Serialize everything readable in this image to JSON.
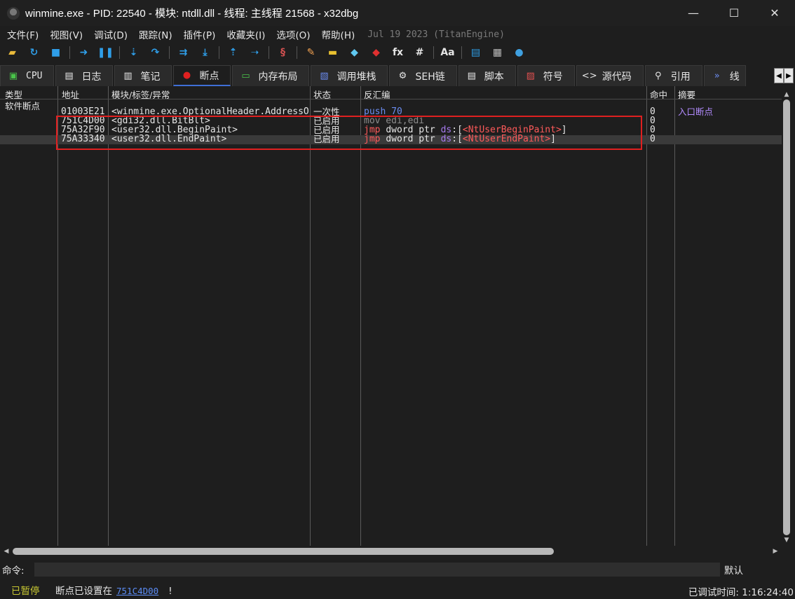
{
  "window": {
    "title": "winmine.exe - PID: 22540 - 模块: ntdll.dll - 线程: 主线程 21568 - x32dbg",
    "controls": {
      "minimize": "—",
      "maximize": "☐",
      "close": "✕"
    }
  },
  "menu": {
    "items": [
      "文件(F)",
      "视图(V)",
      "调试(D)",
      "跟踪(N)",
      "插件(P)",
      "收藏夹(I)",
      "选项(O)",
      "帮助(H)"
    ],
    "build_date": "Jul 19 2023 (TitanEngine)"
  },
  "toolbar": {
    "buttons": [
      {
        "icon": "open-folder-icon",
        "glyph": "▰",
        "color": "#e8b93a"
      },
      {
        "icon": "restart-icon",
        "glyph": "↻",
        "color": "#2f9ee8"
      },
      {
        "icon": "stop-icon",
        "glyph": "■",
        "color": "#2f9ee8"
      },
      {
        "icon": "run-icon",
        "glyph": "➜",
        "color": "#2f9ee8"
      },
      {
        "icon": "pause-icon",
        "glyph": "❚❚",
        "color": "#2f9ee8"
      },
      {
        "icon": "step-into-icon",
        "glyph": "⇣",
        "color": "#2f9ee8"
      },
      {
        "icon": "step-over-icon",
        "glyph": "↷",
        "color": "#2f9ee8"
      },
      {
        "icon": "trace-into-icon",
        "glyph": "⇉",
        "color": "#2f9ee8"
      },
      {
        "icon": "trace-over-icon",
        "glyph": "⤓",
        "color": "#2f9ee8"
      },
      {
        "icon": "execute-till-return-icon",
        "glyph": "⇡",
        "color": "#2f9ee8"
      },
      {
        "icon": "run-to-user-code-icon",
        "glyph": "➝",
        "color": "#2f9ee8"
      },
      {
        "icon": "scylla-icon",
        "glyph": "§",
        "color": "#d05050"
      },
      {
        "icon": "patch-icon",
        "glyph": "✎",
        "color": "#f0a050"
      },
      {
        "icon": "comments-icon",
        "glyph": "▬",
        "color": "#e8c030"
      },
      {
        "icon": "labels-icon",
        "glyph": "◆",
        "color": "#60c8f0"
      },
      {
        "icon": "bookmarks-icon",
        "glyph": "◆",
        "color": "#e03030"
      },
      {
        "icon": "functions-icon",
        "glyph": "fx",
        "color": "#e6e6e6"
      },
      {
        "icon": "hash-icon",
        "glyph": "#",
        "color": "#e6e6e6"
      },
      {
        "icon": "font-icon",
        "glyph": "Aa",
        "color": "#e6e6e6"
      },
      {
        "icon": "calculator-script-icon",
        "glyph": "▤",
        "color": "#2f9ee8"
      },
      {
        "icon": "calculator-icon",
        "glyph": "▦",
        "color": "#bdbdbd"
      },
      {
        "icon": "globe-icon",
        "glyph": "●",
        "color": "#3fa0e0"
      }
    ]
  },
  "tabs": [
    {
      "icon": "cpu-icon",
      "glyph": "▣",
      "color": "#49c449",
      "label": "CPU"
    },
    {
      "icon": "log-icon",
      "glyph": "▤",
      "color": "#e6e6e6",
      "label": "日志"
    },
    {
      "icon": "notes-icon",
      "glyph": "▥",
      "color": "#e6e6e6",
      "label": "笔记"
    },
    {
      "icon": "breakpoint-dot-icon",
      "glyph": "●",
      "color": "#e02020",
      "label": "断点",
      "active": true
    },
    {
      "icon": "memory-map-icon",
      "glyph": "▭",
      "color": "#49c449",
      "label": "内存布局"
    },
    {
      "icon": "call-stack-icon",
      "glyph": "▧",
      "color": "#6b8cf0",
      "label": "调用堆栈"
    },
    {
      "icon": "seh-chain-icon",
      "glyph": "⚙",
      "color": "#e6e6e6",
      "label": "SEH链"
    },
    {
      "icon": "script-icon",
      "glyph": "▤",
      "color": "#e6e6e6",
      "label": "脚本"
    },
    {
      "icon": "symbols-icon",
      "glyph": "▨",
      "color": "#e05050",
      "label": "符号"
    },
    {
      "icon": "source-icon",
      "glyph": "<>",
      "color": "#e6e6e6",
      "label": "源代码"
    },
    {
      "icon": "references-icon",
      "glyph": "⚲",
      "color": "#e6e6e6",
      "label": "引用"
    },
    {
      "icon": "threads-icon",
      "glyph": "»",
      "color": "#6b8cf0",
      "label": "线"
    }
  ],
  "breakpoints": {
    "headers": {
      "type": "类型",
      "address": "地址",
      "module": "模块/标签/异常",
      "state": "状态",
      "disassembly": "反汇编",
      "hits": "命中",
      "summary": "摘要"
    },
    "group_label": "软件断点",
    "rows": [
      {
        "address": "01003E21",
        "module": "<winmine.exe.OptionalHeader.AddressOfEntryPoint>",
        "state": "一次性",
        "dis": [
          {
            "t": "push ",
            "c": "c-blue"
          },
          {
            "t": "70",
            "c": "c-blue"
          }
        ],
        "hits": "0",
        "summary": "入口断点"
      },
      {
        "address": "751C4D00",
        "module": "<gdi32.dll.BitBlt>",
        "state": "已启用",
        "dis": [
          {
            "t": "mov edi,edi",
            "c": "c-gray"
          }
        ],
        "hits": "0",
        "summary": ""
      },
      {
        "address": "75A32F90",
        "module": "<user32.dll.BeginPaint>",
        "state": "已启用",
        "dis": [
          {
            "t": "jmp ",
            "c": "c-red"
          },
          {
            "t": "dword ptr ",
            "c": "c-white"
          },
          {
            "t": "ds",
            "c": "c-purple"
          },
          {
            "t": ":[",
            "c": "c-white"
          },
          {
            "t": "<NtUserBeginPaint>",
            "c": "c-red"
          },
          {
            "t": "]",
            "c": "c-white"
          }
        ],
        "hits": "0",
        "summary": ""
      },
      {
        "address": "75A33340",
        "module": "<user32.dll.EndPaint>",
        "state": "已启用",
        "dis": [
          {
            "t": "jmp ",
            "c": "c-red"
          },
          {
            "t": "dword ptr ",
            "c": "c-white"
          },
          {
            "t": "ds",
            "c": "c-purple"
          },
          {
            "t": ":[",
            "c": "c-white"
          },
          {
            "t": "<NtUserEndPaint>",
            "c": "c-red"
          },
          {
            "t": "]",
            "c": "c-white"
          }
        ],
        "hits": "0",
        "summary": "",
        "selected": true
      }
    ]
  },
  "command": {
    "label": "命令:",
    "value": "",
    "mode": "默认"
  },
  "status": {
    "state": "已暂停",
    "message": "断点已设置在",
    "address_link": "751C4D00",
    "exclamation": "!",
    "debug_time": "已调试时间:  1:16:24:40"
  }
}
